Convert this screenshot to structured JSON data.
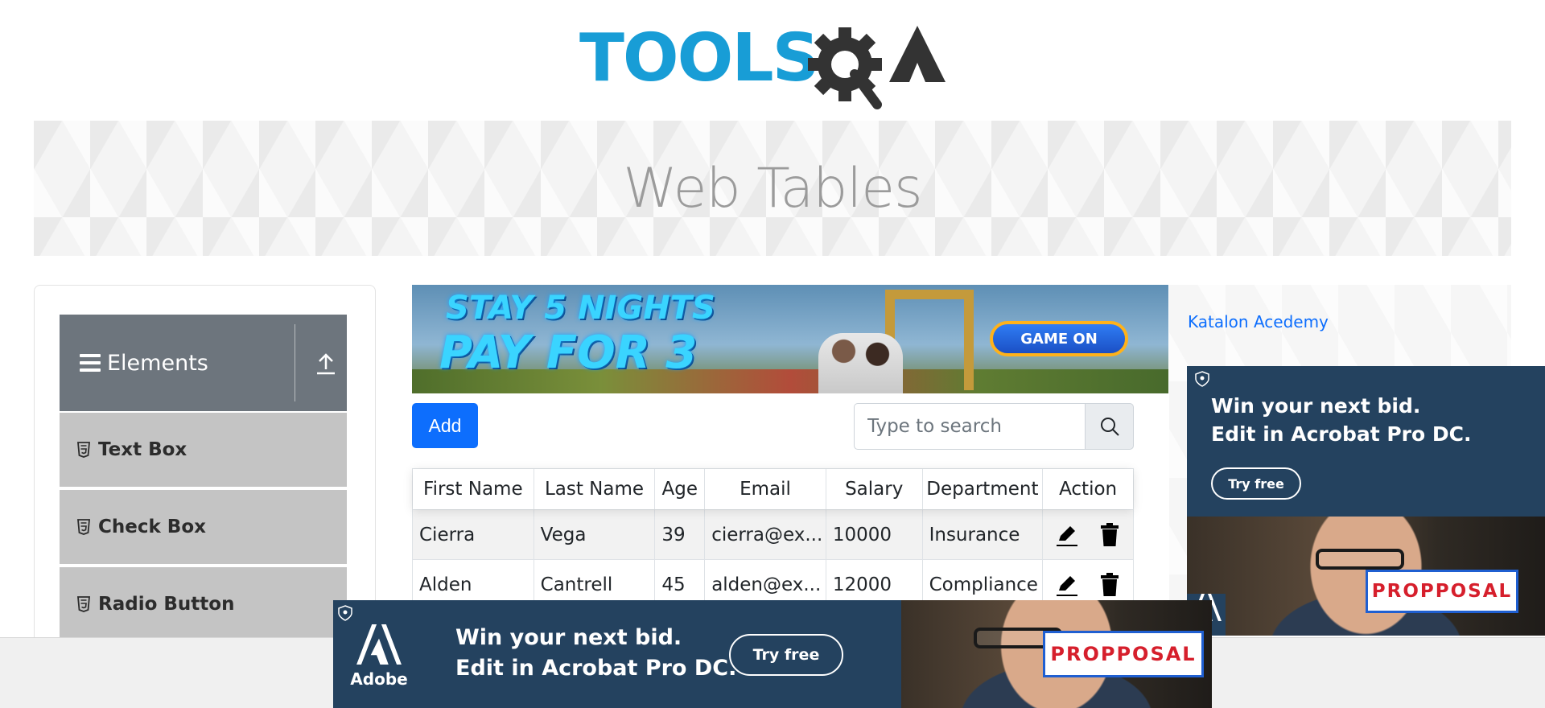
{
  "logo": {
    "text": "TOOLSQA",
    "icon": "toolsqa-gear-logo",
    "color": "#189dd6"
  },
  "banner": {
    "title": "Web Tables"
  },
  "sidebar": {
    "group": {
      "title": "Elements",
      "icon": "hamburger-icon",
      "collapse_icon": "upload-icon"
    },
    "items": [
      {
        "label": "Text Box",
        "icon": "html5-icon"
      },
      {
        "label": "Check Box",
        "icon": "html5-icon"
      },
      {
        "label": "Radio Button",
        "icon": "html5-icon"
      }
    ]
  },
  "promo_ad": {
    "line1": "STAY 5 NIGHTS",
    "line2": "PAY FOR 3",
    "button": "GAME ON"
  },
  "controls": {
    "add_label": "Add",
    "search_placeholder": "Type to search",
    "search_icon": "search-icon"
  },
  "table": {
    "headers": [
      "First Name",
      "Last Name",
      "Age",
      "Email",
      "Salary",
      "Department",
      "Action"
    ],
    "rows": [
      {
        "first": "Cierra",
        "last": "Vega",
        "age": "39",
        "email": "cierra@ex...",
        "salary": "10000",
        "department": "Insurance"
      },
      {
        "first": "Alden",
        "last": "Cantrell",
        "age": "45",
        "email": "alden@ex...",
        "salary": "12000",
        "department": "Compliance"
      }
    ]
  },
  "right": {
    "link": "Katalon Acedemy"
  },
  "adobe_ad": {
    "line1": "Win your next bid.",
    "line2": "Edit in Acrobat Pro DC.",
    "button": "Try free",
    "word": "PROPPOSAL",
    "brand": "Adobe"
  },
  "colors": {
    "primary": "#0d6efd",
    "sidebar_header": "#6d757d",
    "menu_item": "#c4c4c4",
    "ad_bg": "#24425f"
  }
}
